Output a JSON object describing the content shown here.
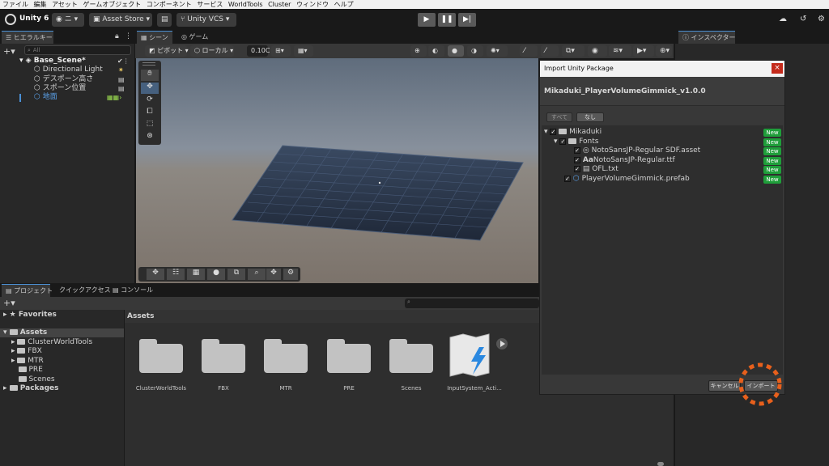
{
  "menu": [
    "ファイル",
    "編集",
    "アセット",
    "ゲームオブジェクト",
    "コンポーネント",
    "サービス",
    "WorldTools",
    "Cluster",
    "ウィンドウ",
    "ヘルプ"
  ],
  "toolbar": {
    "unity_version": "Unity 6",
    "account_label": "ニ",
    "asset_store": "Asset Store",
    "unity_vcs": "Unity VCS"
  },
  "hierarchy": {
    "tab": "ヒエラルキー",
    "search_placeholder": "All",
    "scene_name": "Base_Scene*",
    "items": [
      "Directional Light",
      "デスポーン高さ",
      "スポーン位置",
      "地面"
    ]
  },
  "scene_view": {
    "tab_scene": "シーン",
    "tab_game": "ゲーム",
    "pivot": "ピボット",
    "local": "ローカル",
    "snap_value": "0.10C"
  },
  "inspector": {
    "tab": "インスペクター"
  },
  "project": {
    "tabs": [
      "プロジェクト",
      "クイックアクセス",
      "コンソール"
    ],
    "favorites": "Favorites",
    "assets_root": "Assets",
    "folders": [
      "ClusterWorldTools",
      "FBX",
      "MTR",
      "PRE",
      "Scenes"
    ],
    "packages": "Packages",
    "assets_header": "Assets",
    "asset_items": [
      "ClusterWorldTools",
      "FBX",
      "MTR",
      "PRE",
      "Scenes",
      "InputSystem_Acti..."
    ]
  },
  "dialog": {
    "title": "Import Unity Package",
    "close": "×",
    "package_name": "Mikaduki_PlayerVolumeGimmick_v1.0.0",
    "all_button": "すべて",
    "none_button": "なし",
    "tree": [
      {
        "label": "Mikaduki",
        "badge": "New"
      },
      {
        "label": "Fonts",
        "badge": "New"
      },
      {
        "label": "NotoSansJP-Regular SDF.asset",
        "badge": "New"
      },
      {
        "label": "NotoSansJP-Regular.ttf",
        "badge": "New",
        "icon_text": "Aa"
      },
      {
        "label": "OFL.txt",
        "badge": "New"
      },
      {
        "label": "PlayerVolumeGimmick.prefab",
        "badge": "New"
      }
    ],
    "cancel_button": "キャンセル",
    "import_button": "インポート"
  },
  "colors": {
    "accent": "#4a8fd4",
    "new_badge": "#1f9e3a",
    "highlight_ring": "#e8601c"
  }
}
